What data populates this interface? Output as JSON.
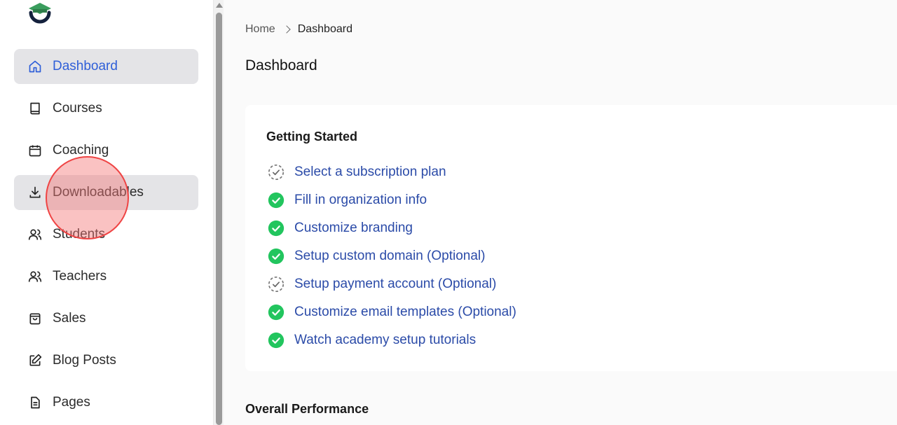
{
  "brand": {
    "logo_icon": "graduation-cap-logo-icon",
    "accent_color": "#2f5fd8",
    "success_color": "#22c55e",
    "link_color": "#2b4ba8"
  },
  "sidebar": {
    "items": [
      {
        "label": "Dashboard",
        "icon": "home-icon",
        "active": true
      },
      {
        "label": "Courses",
        "icon": "book-icon"
      },
      {
        "label": "Coaching",
        "icon": "calendar-icon"
      },
      {
        "label": "Downloadables",
        "icon": "download-icon"
      },
      {
        "label": "Students",
        "icon": "users-icon"
      },
      {
        "label": "Teachers",
        "icon": "users-icon"
      },
      {
        "label": "Sales",
        "icon": "shopping-bag-icon"
      },
      {
        "label": "Blog Posts",
        "icon": "edit-icon"
      },
      {
        "label": "Pages",
        "icon": "document-icon"
      }
    ]
  },
  "breadcrumb": {
    "home": "Home",
    "current": "Dashboard"
  },
  "page": {
    "title": "Dashboard"
  },
  "getting_started": {
    "title": "Getting Started",
    "tasks": [
      {
        "label": "Select a subscription plan",
        "done": false
      },
      {
        "label": "Fill in organization info",
        "done": true
      },
      {
        "label": "Customize branding",
        "done": true
      },
      {
        "label": "Setup custom domain (Optional)",
        "done": true
      },
      {
        "label": "Setup payment account (Optional)",
        "done": false
      },
      {
        "label": "Customize email templates (Optional)",
        "done": true
      },
      {
        "label": "Watch academy setup tutorials",
        "done": true
      }
    ]
  },
  "performance": {
    "title": "Overall Performance"
  }
}
